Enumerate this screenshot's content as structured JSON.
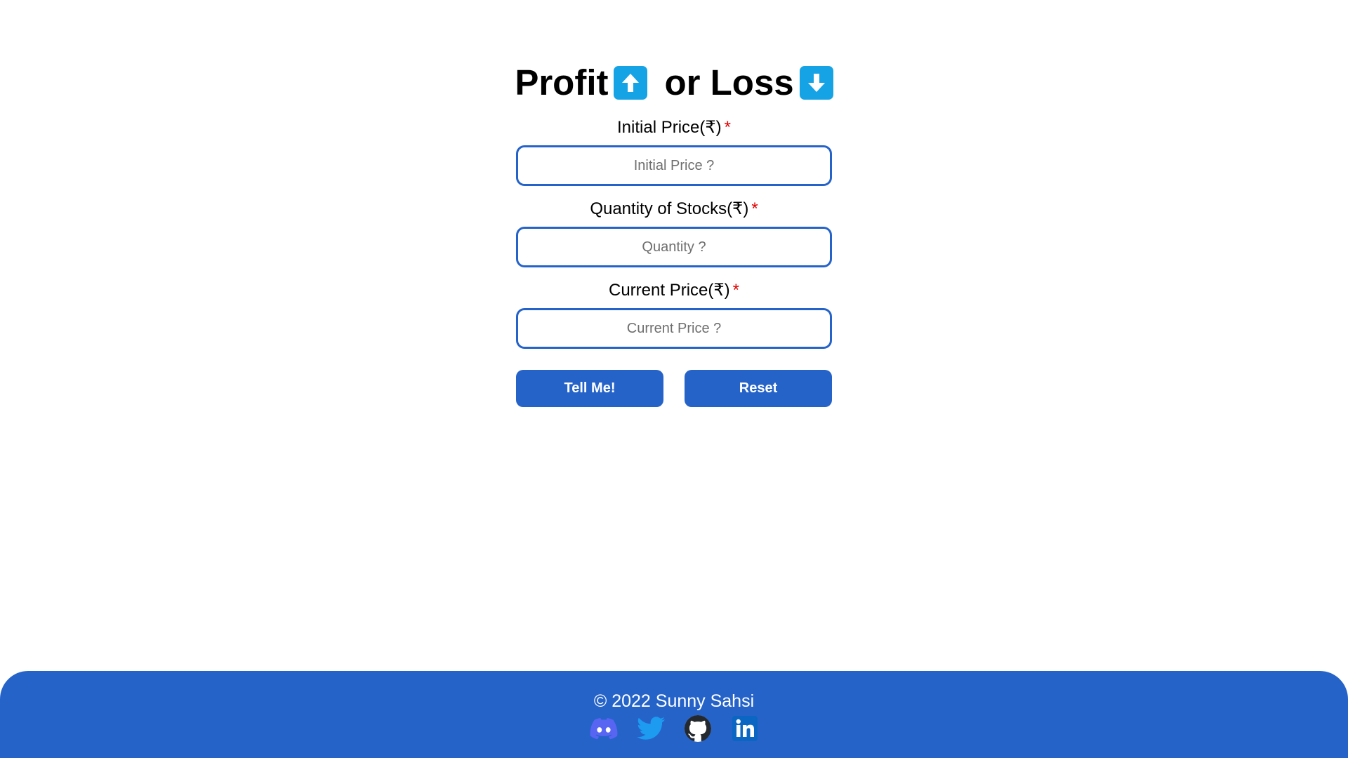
{
  "header": {
    "title_profit": "Profit",
    "title_or_loss": "or Loss",
    "profit_icon": "up-arrow-emoji",
    "loss_icon": "down-arrow-emoji"
  },
  "form": {
    "initial_price": {
      "label": "Initial Price(₹)",
      "required_mark": "*",
      "placeholder": "Initial Price ?",
      "value": ""
    },
    "quantity": {
      "label": "Quantity of Stocks(₹)",
      "required_mark": "*",
      "placeholder": "Quantity ?",
      "value": ""
    },
    "current_price": {
      "label": "Current Price(₹)",
      "required_mark": "*",
      "placeholder": "Current Price ?",
      "value": ""
    },
    "submit_label": "Tell Me!",
    "reset_label": "Reset"
  },
  "footer": {
    "copyright": "© 2022 Sunny Sahsi",
    "social_icons": [
      "discord-icon",
      "twitter-icon",
      "github-icon",
      "linkedin-icon"
    ]
  },
  "colors": {
    "accent": "#2563c9",
    "emoji_bg": "#16a3e6",
    "required": "#e00000",
    "discord": "#5865f2",
    "twitter": "#1d9bf0",
    "github": "#24292f",
    "linkedin": "#0a66c2"
  }
}
